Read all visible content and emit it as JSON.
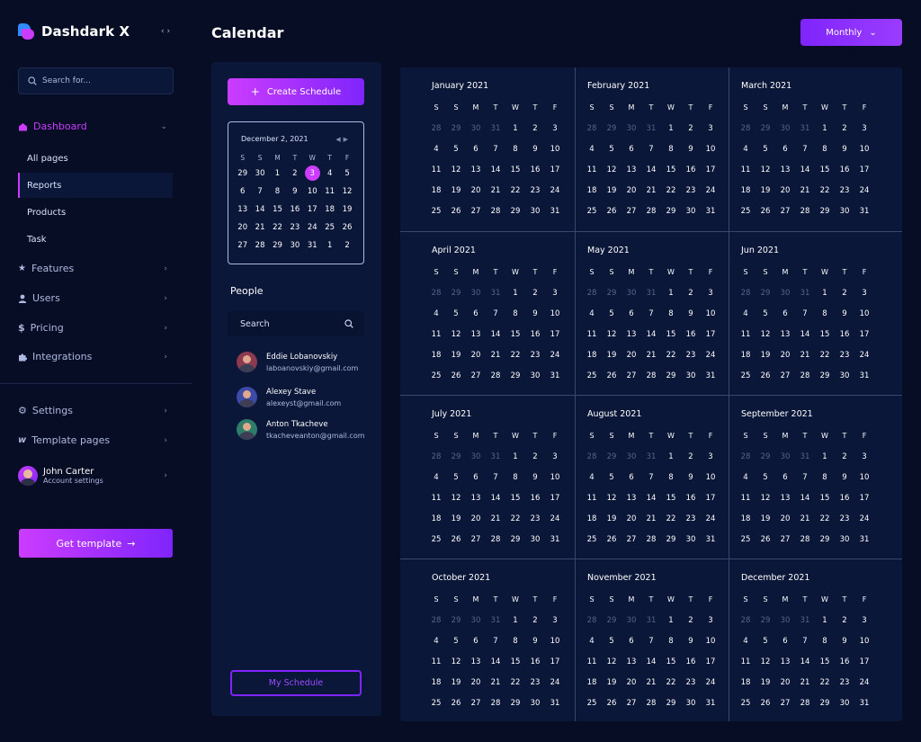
{
  "brand": {
    "name": "Dashdark X"
  },
  "sidebar": {
    "search_placeholder": "Search for...",
    "nav": [
      {
        "label": "Dashboard"
      },
      {
        "label": "Features"
      },
      {
        "label": "Users"
      },
      {
        "label": "Pricing"
      },
      {
        "label": "Integrations"
      },
      {
        "label": "Settings"
      },
      {
        "label": "Template pages"
      }
    ],
    "sub_items": [
      "All pages",
      "Reports",
      "Products",
      "Task"
    ],
    "user": {
      "name": "John Carter",
      "subtitle": "Account settings"
    },
    "cta": "Get template"
  },
  "header": {
    "title": "Calendar",
    "view_select": "Monthly"
  },
  "scheduler": {
    "create_label": "Create Schedule",
    "mini_calendar": {
      "title": "December 2, 2021",
      "weekdays": [
        "S",
        "S",
        "M",
        "T",
        "W",
        "T",
        "F"
      ],
      "days": [
        "29",
        "30",
        "1",
        "2",
        "3",
        "4",
        "5",
        "6",
        "7",
        "8",
        "9",
        "10",
        "11",
        "12",
        "13",
        "14",
        "15",
        "16",
        "17",
        "18",
        "19",
        "20",
        "21",
        "22",
        "23",
        "24",
        "25",
        "26",
        "27",
        "28",
        "29",
        "30",
        "31",
        "1",
        "2"
      ],
      "selected": "3"
    },
    "people_title": "People",
    "people_search_placeholder": "Search",
    "people": [
      {
        "name": "Eddie Lobanovskiy",
        "email": "laboanovskiy@gmail.com",
        "color": "#8c3a4f"
      },
      {
        "name": "Alexey Stave",
        "email": "alexeyst@gmail.com",
        "color": "#3c4aa8"
      },
      {
        "name": "Anton Tkacheve",
        "email": "tkacheveanton@gmail.com",
        "color": "#2e7d6b"
      }
    ],
    "my_schedule_label": "My Schedule"
  },
  "year": {
    "weekdays": [
      "S",
      "S",
      "M",
      "T",
      "W",
      "T",
      "F"
    ],
    "lead_days": [
      "28",
      "29",
      "30",
      "31"
    ],
    "days": [
      "1",
      "2",
      "3",
      "4",
      "5",
      "6",
      "7",
      "8",
      "9",
      "10",
      "11",
      "12",
      "13",
      "14",
      "15",
      "16",
      "17",
      "18",
      "19",
      "20",
      "21",
      "22",
      "23",
      "24",
      "25",
      "26",
      "27",
      "28",
      "29",
      "30",
      "31"
    ],
    "months": [
      "January  2021",
      "February  2021",
      "March  2021",
      "April  2021",
      "May  2021",
      "Jun  2021",
      "July  2021",
      "August  2021",
      "September  2021",
      "October  2021",
      "November  2021",
      "December  2021"
    ]
  },
  "colors": {
    "accent": "#cb3cff",
    "accent2": "#7f25fb",
    "bg": "#070d24",
    "panel": "#0b1739"
  }
}
